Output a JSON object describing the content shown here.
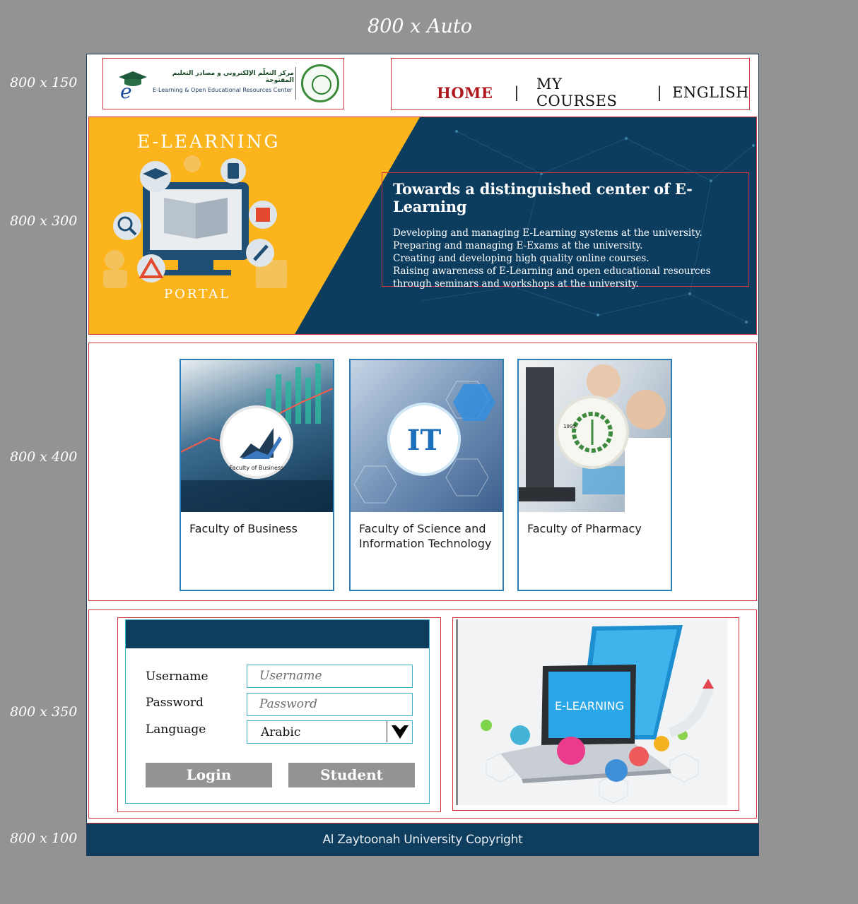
{
  "spec_title": "800  x Auto",
  "section_sizes": [
    "800 x 150",
    "800 x 300",
    "800 x 400",
    "800 x 350",
    "800 x 100"
  ],
  "header": {
    "logo_arabic": "مركز التعلّم الإلكتروني و مصادر التعليم المفتوحة",
    "logo_english": "E-Learning & Open Educational Resources Center",
    "nav": {
      "home": "HOME",
      "courses": "MY COURSES",
      "language": "ENGLISH",
      "separator": "|"
    }
  },
  "hero": {
    "banner_top": "E-LEARNING",
    "banner_bottom": "PORTAL",
    "title": "Towards a distinguished center of E-Learning",
    "lines": [
      "Developing and managing E-Learning systems at the university.",
      "Preparing and managing E-Exams at the university.",
      "Creating and developing high quality online courses.",
      "Raising awareness of E-Learning and open educational resources through seminars and workshops at the university."
    ]
  },
  "faculties": [
    {
      "label": "Faculty of Business",
      "badge": "Faculty of Business"
    },
    {
      "label": "Faculty of Science and Information Technology",
      "badge": "IT"
    },
    {
      "label": "Faculty of Pharmacy",
      "badge": "1993"
    }
  ],
  "login": {
    "username_label": "Username",
    "username_placeholder": "Username",
    "password_label": "Password",
    "password_placeholder": "Password",
    "language_label": "Language",
    "language_value": "Arabic",
    "login_button": "Login",
    "student_button": "Student"
  },
  "illustration": {
    "screen_text": "E-LEARNING"
  },
  "footer": {
    "copyright": "Al Zaytoonah University Copyright"
  },
  "colors": {
    "navy": "#0e3d5e",
    "yellow": "#fbb41c",
    "red": "#b01820",
    "cyan": "#3db0cc",
    "button_gray": "#939393"
  }
}
